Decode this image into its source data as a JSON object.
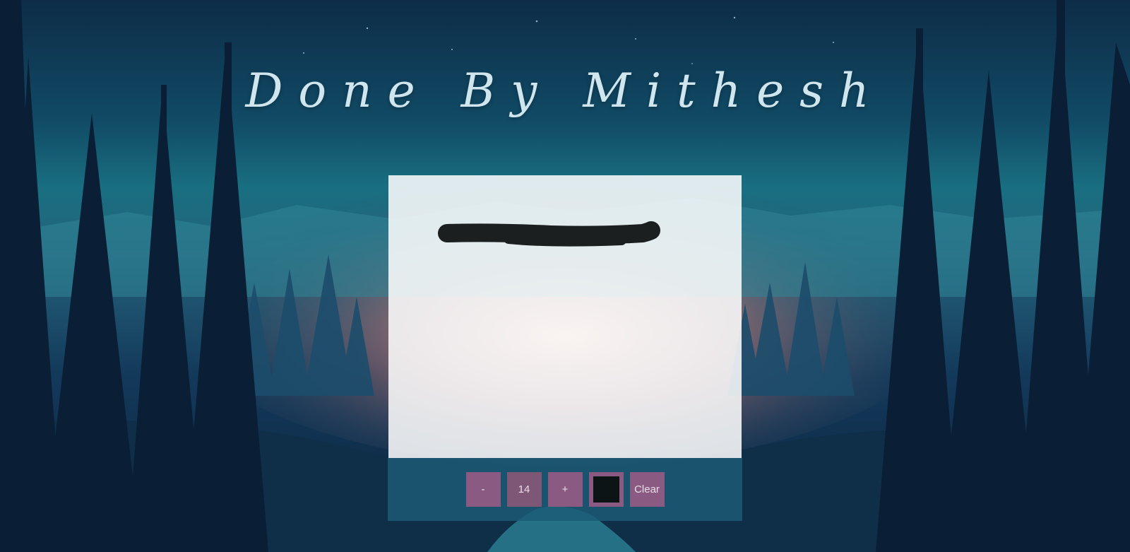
{
  "page": {
    "title": "Done By Mithesh"
  },
  "toolbox": {
    "decrease_label": "-",
    "size_value": "14",
    "increase_label": "+",
    "color_value": "#0c1416",
    "clear_label": "Clear"
  },
  "colors": {
    "canvas_background": "#ffffff",
    "toolbox_background": "#1c5c76",
    "button_background": "#8b5a83",
    "stroke_color": "#1b1f1f"
  }
}
